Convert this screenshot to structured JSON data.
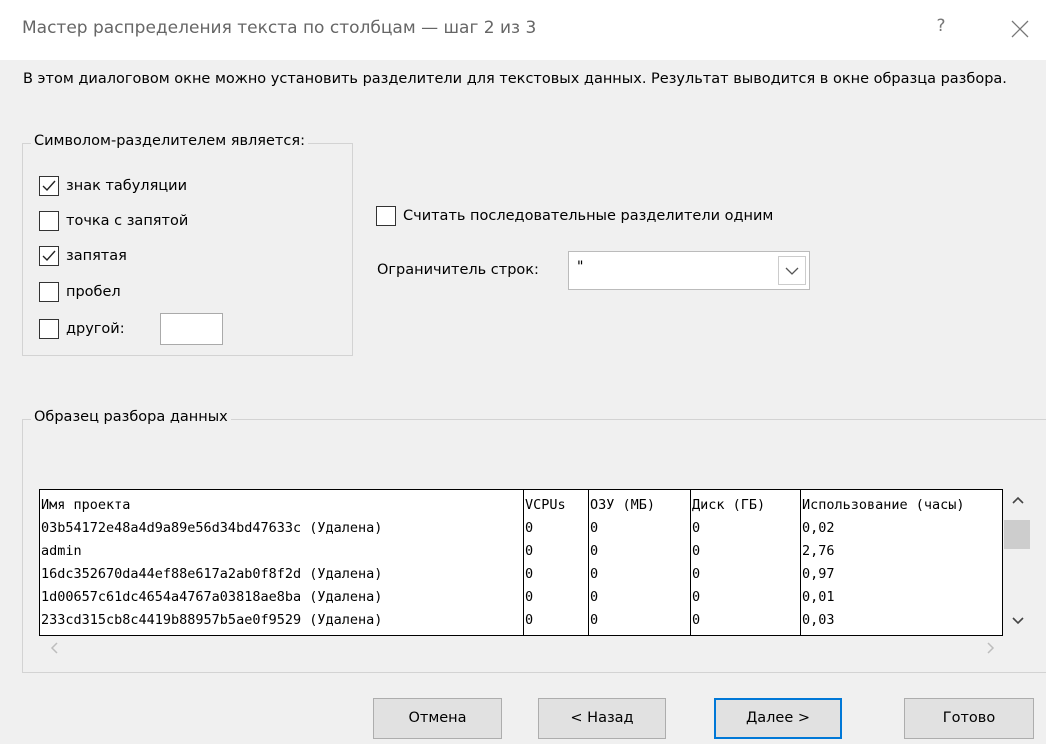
{
  "dialog": {
    "title": "Мастер распределения текста по столбцам — шаг 2 из 3",
    "help": "?",
    "description": "В этом диалоговом окне можно установить разделители для текстовых данных. Результат выводится в окне образца разбора."
  },
  "delimiters": {
    "legend": "Символом-разделителем является:",
    "tab": {
      "label": "знак табуляции",
      "checked": true
    },
    "semicolon": {
      "label": "точка с запятой",
      "checked": false
    },
    "comma": {
      "label": "запятая",
      "checked": true
    },
    "space": {
      "label": "пробел",
      "checked": false
    },
    "other": {
      "label": "другой:",
      "checked": false,
      "value": ""
    }
  },
  "consecutive": {
    "label": "Считать последовательные разделители одним",
    "checked": false
  },
  "qualifier": {
    "label": "Ограничитель строк:",
    "value": "\""
  },
  "preview": {
    "legend": "Образец разбора данных",
    "columns": [
      "Имя проекта",
      "VCPUs",
      "ОЗУ (МБ)",
      "Диск (ГБ)",
      "Использование (часы)"
    ],
    "rows": [
      [
        "03b54172e48a4d9a89e56d34bd47633c (Удалена)",
        "0",
        "0",
        "0",
        "0,02"
      ],
      [
        "admin",
        "0",
        "0",
        "0",
        "2,76"
      ],
      [
        "16dc352670da44ef88e617a2ab0f8f2d (Удалена)",
        "0",
        "0",
        "0",
        "0,97"
      ],
      [
        "1d00657c61dc4654a4767a03818ae8ba (Удалена)",
        "0",
        "0",
        "0",
        "0,01"
      ],
      [
        "233cd315cb8c4419b88957b5ae0f9529 (Удалена)",
        "0",
        "0",
        "0",
        "0,03"
      ],
      [
        "",
        "",
        "",
        "",
        ""
      ]
    ]
  },
  "buttons": {
    "cancel": "Отмена",
    "back": "< Назад",
    "next": "Далее >",
    "finish": "Готово"
  },
  "colors": {
    "default_button_border": "#0078d7",
    "button_face": "#e1e1e1",
    "dialog_bg": "#f0f0f0"
  }
}
